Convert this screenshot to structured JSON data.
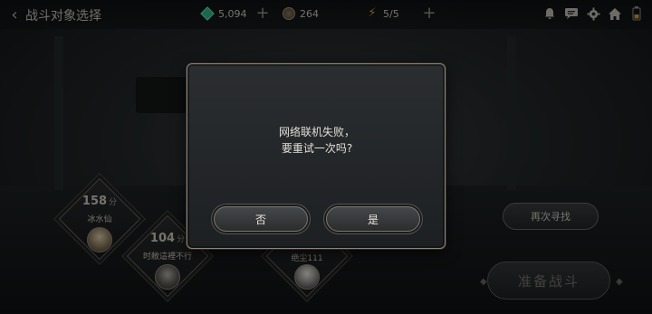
{
  "header": {
    "back_label": "‹",
    "title": "战斗对象选择"
  },
  "resources": {
    "gems": "5,094",
    "coins": "264",
    "energy": "5/5",
    "plus": "+"
  },
  "system_icons": [
    "bell-icon",
    "chat-icon",
    "gear-icon",
    "home-icon",
    "battery-icon"
  ],
  "opponents": [
    {
      "score": "158",
      "unit": "分",
      "name": "冰水仙"
    },
    {
      "score": "104",
      "unit": "分",
      "name": "时敝這裡不行"
    },
    {
      "score": "",
      "unit": "",
      "name": "绝尘111"
    }
  ],
  "actions": {
    "search_again": "再次寻找",
    "prepare_battle": "准备战斗"
  },
  "dialog": {
    "line1": "网络联机失败，",
    "line2": "要重试一次吗?",
    "no_label": "否",
    "yes_label": "是"
  },
  "colors": {
    "accent_gold": "#8d8678",
    "gem_green": "#2fbf8f",
    "energy_orange": "#d7a24a"
  }
}
